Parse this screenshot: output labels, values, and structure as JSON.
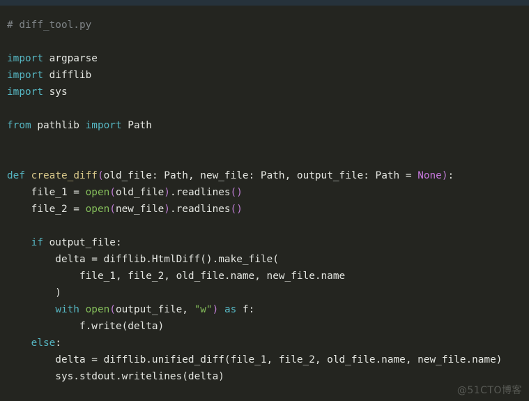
{
  "window": {
    "titlebar_color": "#26323b",
    "editor_background": "#242520",
    "language": "python",
    "filename": "diff_tool.py"
  },
  "theme": {
    "name": "one-dark-variant",
    "background": "#242520",
    "foreground": "#e4e6e1",
    "comment": "#7f8487",
    "keyword": "#56b6c2",
    "function": "#d9c98a",
    "builtin": "#84bd5a",
    "string": "#84bd5a",
    "constant": "#c678dd",
    "punctuation": "#c07ed6",
    "operator": "#d9dbd5"
  },
  "watermark": {
    "text": "@51CTO博客",
    "color": "#585a55"
  },
  "code": {
    "lines": [
      [
        {
          "t": "# diff_tool.py",
          "c": "comment"
        }
      ],
      [
        {
          "t": "",
          "c": "plain"
        }
      ],
      [
        {
          "t": "import",
          "c": "kw"
        },
        {
          "t": " argparse",
          "c": "plain"
        }
      ],
      [
        {
          "t": "import",
          "c": "kw"
        },
        {
          "t": " difflib",
          "c": "plain"
        }
      ],
      [
        {
          "t": "import",
          "c": "kw"
        },
        {
          "t": " sys",
          "c": "plain"
        }
      ],
      [
        {
          "t": "",
          "c": "plain"
        }
      ],
      [
        {
          "t": "from",
          "c": "kw"
        },
        {
          "t": " pathlib ",
          "c": "plain"
        },
        {
          "t": "import",
          "c": "kw"
        },
        {
          "t": " Path",
          "c": "plain"
        }
      ],
      [
        {
          "t": "",
          "c": "plain"
        }
      ],
      [
        {
          "t": "",
          "c": "plain"
        }
      ],
      [
        {
          "t": "def",
          "c": "kw"
        },
        {
          "t": " ",
          "c": "plain"
        },
        {
          "t": "create_diff",
          "c": "fn"
        },
        {
          "t": "(",
          "c": "punc"
        },
        {
          "t": "old_file: Path, new_file: Path, output_file: Path = ",
          "c": "plain"
        },
        {
          "t": "None",
          "c": "const"
        },
        {
          "t": ")",
          "c": "punc"
        },
        {
          "t": ":",
          "c": "plain"
        }
      ],
      [
        {
          "t": "    file_1 = ",
          "c": "plain"
        },
        {
          "t": "open",
          "c": "builtin"
        },
        {
          "t": "(",
          "c": "punc"
        },
        {
          "t": "old_file",
          "c": "plain"
        },
        {
          "t": ")",
          "c": "punc"
        },
        {
          "t": ".readlines",
          "c": "plain"
        },
        {
          "t": "()",
          "c": "punc"
        }
      ],
      [
        {
          "t": "    file_2 = ",
          "c": "plain"
        },
        {
          "t": "open",
          "c": "builtin"
        },
        {
          "t": "(",
          "c": "punc"
        },
        {
          "t": "new_file",
          "c": "plain"
        },
        {
          "t": ")",
          "c": "punc"
        },
        {
          "t": ".readlines",
          "c": "plain"
        },
        {
          "t": "()",
          "c": "punc"
        }
      ],
      [
        {
          "t": "",
          "c": "plain"
        }
      ],
      [
        {
          "t": "    ",
          "c": "plain"
        },
        {
          "t": "if",
          "c": "kw"
        },
        {
          "t": " output_file:",
          "c": "plain"
        }
      ],
      [
        {
          "t": "        delta = difflib.HtmlDiff().make_file(",
          "c": "plain"
        }
      ],
      [
        {
          "t": "            file_1, file_2, old_file.name, new_file.name",
          "c": "plain"
        }
      ],
      [
        {
          "t": "        )",
          "c": "plain"
        }
      ],
      [
        {
          "t": "        ",
          "c": "plain"
        },
        {
          "t": "with",
          "c": "kw"
        },
        {
          "t": " ",
          "c": "plain"
        },
        {
          "t": "open",
          "c": "builtin"
        },
        {
          "t": "(",
          "c": "punc"
        },
        {
          "t": "output_file, ",
          "c": "plain"
        },
        {
          "t": "\"w\"",
          "c": "str"
        },
        {
          "t": ")",
          "c": "punc"
        },
        {
          "t": " ",
          "c": "plain"
        },
        {
          "t": "as",
          "c": "kw"
        },
        {
          "t": " f:",
          "c": "plain"
        }
      ],
      [
        {
          "t": "            f.write(delta)",
          "c": "plain"
        }
      ],
      [
        {
          "t": "    ",
          "c": "plain"
        },
        {
          "t": "else",
          "c": "kw"
        },
        {
          "t": ":",
          "c": "plain"
        }
      ],
      [
        {
          "t": "        delta = difflib.unified_diff(file_1, file_2, old_file.name, new_file.name)",
          "c": "plain"
        }
      ],
      [
        {
          "t": "        sys.stdout.writelines(delta)",
          "c": "plain"
        }
      ]
    ],
    "plain_text": "# diff_tool.py\n\nimport argparse\nimport difflib\nimport sys\n\nfrom pathlib import Path\n\n\ndef create_diff(old_file: Path, new_file: Path, output_file: Path = None):\n    file_1 = open(old_file).readlines()\n    file_2 = open(new_file).readlines()\n\n    if output_file:\n        delta = difflib.HtmlDiff().make_file(\n            file_1, file_2, old_file.name, new_file.name\n        )\n        with open(output_file, \"w\") as f:\n            f.write(delta)\n    else:\n        delta = difflib.unified_diff(file_1, file_2, old_file.name, new_file.name)\n        sys.stdout.writelines(delta)"
  }
}
